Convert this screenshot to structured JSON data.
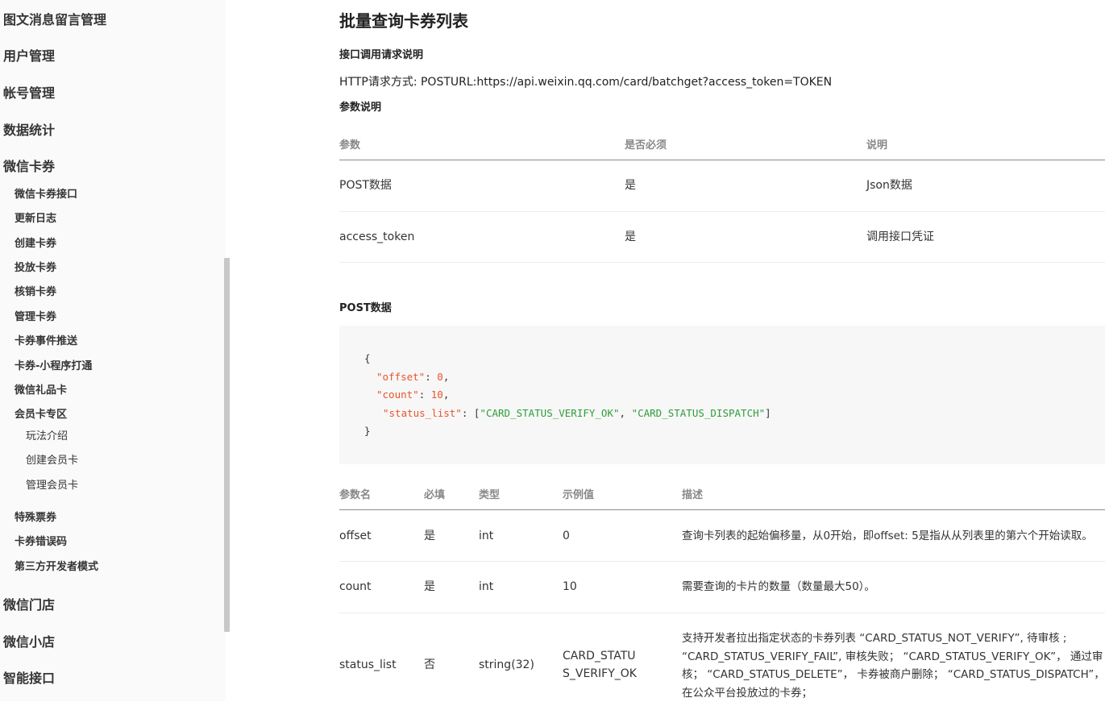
{
  "sidebar": {
    "items": [
      {
        "label": "图文消息留言管理",
        "level": 1
      },
      {
        "label": "用户管理",
        "level": 1
      },
      {
        "label": "帐号管理",
        "level": 1
      },
      {
        "label": "数据统计",
        "level": 1
      },
      {
        "label": "微信卡券",
        "level": 1
      },
      {
        "label": "微信卡券接口",
        "level": 2
      },
      {
        "label": "更新日志",
        "level": 2
      },
      {
        "label": "创建卡券",
        "level": 2
      },
      {
        "label": "投放卡券",
        "level": 2
      },
      {
        "label": "核销卡券",
        "level": 2
      },
      {
        "label": "管理卡券",
        "level": 2
      },
      {
        "label": "卡券事件推送",
        "level": 2
      },
      {
        "label": "卡券-小程序打通",
        "level": 2
      },
      {
        "label": "微信礼品卡",
        "level": 2
      },
      {
        "label": "会员卡专区",
        "level": 2
      },
      {
        "label": "玩法介绍",
        "level": 3
      },
      {
        "label": "创建会员卡",
        "level": 3
      },
      {
        "label": "管理会员卡",
        "level": 3
      },
      {
        "label": "特殊票券",
        "level": 2
      },
      {
        "label": "卡券错误码",
        "level": 2
      },
      {
        "label": "第三方开发者模式",
        "level": 2
      },
      {
        "label": "微信门店",
        "level": 1
      },
      {
        "label": "微信小店",
        "level": 1
      },
      {
        "label": "智能接口",
        "level": 1
      }
    ]
  },
  "main": {
    "title": "批量查询卡券列表",
    "request_heading": "接口调用请求说明",
    "http_line": "HTTP请求方式: POSTURL:https://api.weixin.qq.com/card/batchget?access_token=TOKEN",
    "params_heading": "参数说明",
    "params_table": {
      "headers": [
        "参数",
        "是否必须",
        "说明"
      ],
      "rows": [
        [
          "POST数据",
          "是",
          "Json数据"
        ],
        [
          "access_token",
          "是",
          "调用接口凭证"
        ]
      ]
    },
    "post_heading": "POST数据",
    "code": {
      "open": "{",
      "line1_key": "\"offset\"",
      "line1_val": "0",
      "line2_key": "\"count\"",
      "line2_val": "10",
      "line3_key": "\"status_list\"",
      "line3_val1": "\"CARD_STATUS_VERIFY_OK\"",
      "line3_val2": "\"CARD_STATUS_DISPATCH\"",
      "close": "}"
    },
    "fields_table": {
      "headers": [
        "参数名",
        "必填",
        "类型",
        "示例值",
        "描述"
      ],
      "rows": [
        [
          "offset",
          "是",
          "int",
          "0",
          "查询卡列表的起始偏移量，从0开始，即offset: 5是指从从列表里的第六个开始读取。"
        ],
        [
          "count",
          "是",
          "int",
          "10",
          "需要查询的卡片的数量（数量最大50）。"
        ],
        [
          "status_list",
          "否",
          "string(32)",
          "CARD_STATUS_VERIFY_OK",
          "支持开发者拉出指定状态的卡券列表 “CARD_STATUS_NOT_VERIFY”, 待审核 ; “CARD_STATUS_VERIFY_FAIL”, 审核失败； “CARD_STATUS_VERIFY_OK”， 通过审核； “CARD_STATUS_DELETE”， 卡券被商户删除； “CARD_STATUS_DISPATCH”， 在公众平台投放过的卡券；"
        ]
      ],
      "example_wrap": [
        "CARD_STATU",
        "S_VERIFY_OK"
      ]
    }
  }
}
